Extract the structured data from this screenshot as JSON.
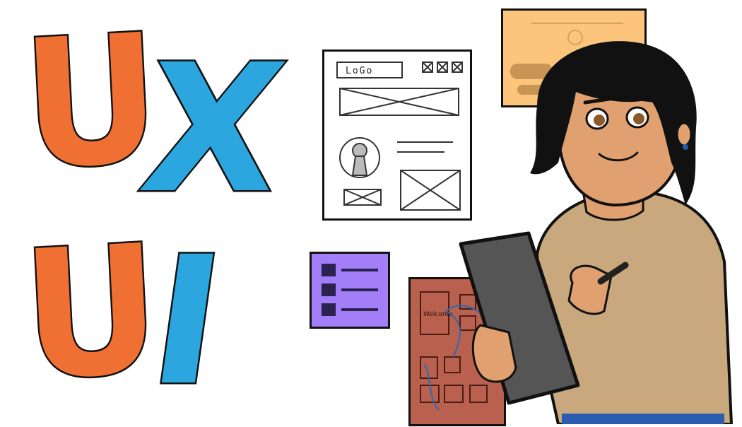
{
  "letters": {
    "u1": "U",
    "x": "X",
    "u2": "U",
    "i": "I"
  },
  "wireframe": {
    "logo_label": "LoGo"
  },
  "storyboard": {
    "welcome_label": "Welcome"
  },
  "colors": {
    "orange": "#F07033",
    "blue": "#2BA6DE",
    "purple": "#A27EF8",
    "peach": "#FDC47C",
    "brick": "#B9614E",
    "sweater": "#C8A87C",
    "skin": "#E0A070",
    "tablet": "#555555",
    "hair": "#111111"
  }
}
